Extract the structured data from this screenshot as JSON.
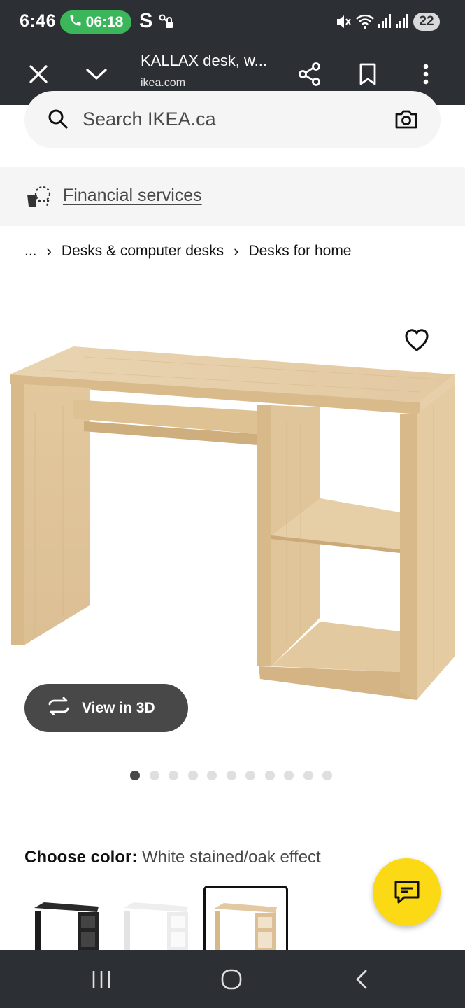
{
  "status_bar": {
    "time": "6:46",
    "call_timer": "06:18",
    "s_app": "S",
    "battery": "22"
  },
  "browser": {
    "title": "KALLAX desk, w...",
    "url": "ikea.com"
  },
  "search": {
    "placeholder": "Search IKEA.ca"
  },
  "financial": {
    "label": "Financial services"
  },
  "breadcrumb": {
    "ellipsis": "...",
    "items": [
      "Desks & computer desks",
      "Desks for home"
    ]
  },
  "product": {
    "view3d_label": "View in 3D",
    "image_count": 11,
    "active_image": 0,
    "choose_color_label": "Choose color:",
    "selected_color": "White stained/oak effect",
    "swatches": [
      "black-brown",
      "white",
      "white-stained-oak"
    ]
  },
  "colors": {
    "chrome_bg": "#2c2f33",
    "call_pill": "#3cb65a",
    "chat_button": "#fbd914",
    "wood_light": "#e8d2af",
    "wood_mid": "#dcc198"
  }
}
